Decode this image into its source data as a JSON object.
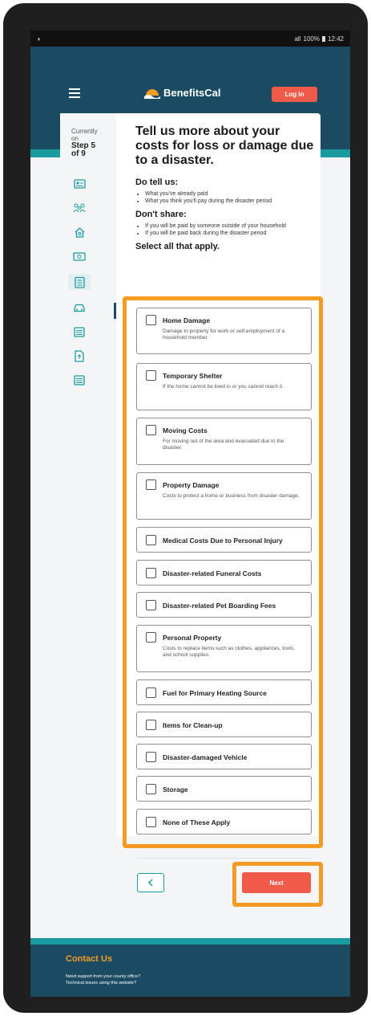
{
  "status": {
    "left": "◖",
    "signal": "all",
    "battery": "100%",
    "time": "12:42"
  },
  "header": {
    "logo_text": "BenefitsCal",
    "login_label": "Log In"
  },
  "progress": {
    "currently": "Currently",
    "on": "on",
    "step": "Step 5",
    "of": "of 9"
  },
  "page": {
    "title": "Tell us more about your costs for loss or damage due to a disaster.",
    "do_tell_us": "Do tell us:",
    "do_tell_items": [
      "What you've already paid",
      "What you think you'll pay during the disaster period"
    ],
    "dont_share": "Don't share:",
    "dont_share_items": [
      "If you will be paid by someone outside of your household",
      "If you will be paid back during the disaster period"
    ],
    "select_all": "Select all that apply."
  },
  "options": [
    {
      "label": "Home Damage",
      "desc": "Damage to property for work or self-employment of a household member."
    },
    {
      "label": "Temporary Shelter",
      "desc": "If the home cannot be lived in or you cannot reach it."
    },
    {
      "label": "Moving Costs",
      "desc": "For moving out of the area and evacuated due to the disaster."
    },
    {
      "label": "Property Damage",
      "desc": "Costs to protect a home or business from disaster damage."
    },
    {
      "label": "Medical Costs Due to Personal Injury",
      "desc": ""
    },
    {
      "label": "Disaster-related Funeral Costs",
      "desc": ""
    },
    {
      "label": "Disaster-related Pet Boarding Fees",
      "desc": ""
    },
    {
      "label": "Personal Property",
      "desc": "Costs to replace items such as clothes, appliances, tools, and school supplies."
    },
    {
      "label": "Fuel for Primary Heating Source",
      "desc": ""
    },
    {
      "label": "Items for Clean-up",
      "desc": ""
    },
    {
      "label": "Disaster-damaged Vehicle",
      "desc": ""
    },
    {
      "label": "Storage",
      "desc": ""
    },
    {
      "label": "None of These Apply",
      "desc": ""
    }
  ],
  "nav": {
    "back_icon": "chevron-left-icon",
    "next_label": "Next"
  },
  "footer": {
    "title": "Contact Us",
    "links": [
      "Need support from your county office?",
      "Technical issues using this website?"
    ]
  },
  "colors": {
    "navy": "#1b4a63",
    "teal": "#1a9b9f",
    "accent": "#ef5a49",
    "highlight": "#f59a23"
  }
}
